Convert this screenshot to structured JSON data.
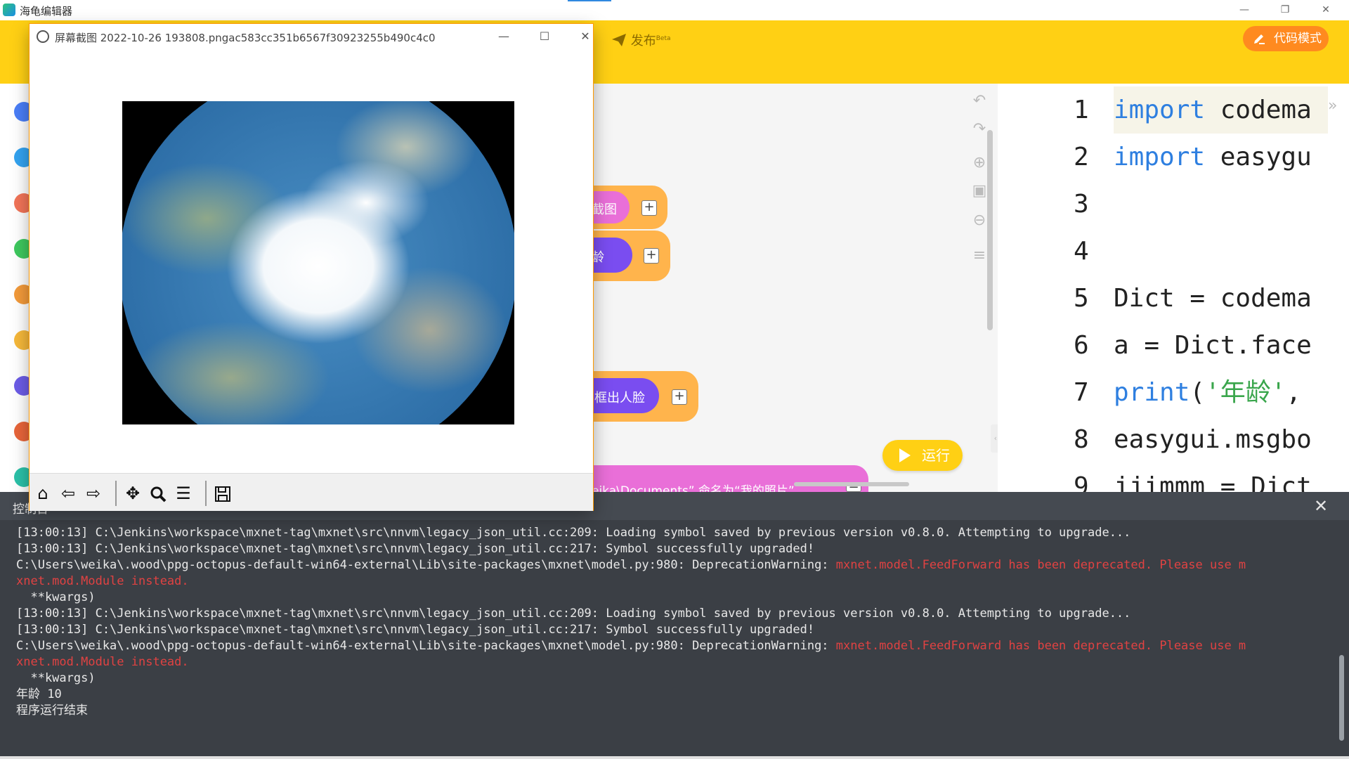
{
  "app": {
    "title": "海龟编辑器",
    "minimize": "—",
    "restore": "❐",
    "close": "✕"
  },
  "header": {
    "publish_label": "发布",
    "publish_badge": "Beta",
    "code_mode_label": "代码模式"
  },
  "sidebar": {
    "categories": [
      {
        "name": "category-1",
        "color": "#4a7ef7"
      },
      {
        "name": "category-2",
        "color": "#33a3f0"
      },
      {
        "name": "category-3",
        "color": "#f27458"
      },
      {
        "name": "category-4",
        "color": "#3ec85e"
      },
      {
        "name": "category-5",
        "color": "#f39a3a"
      },
      {
        "name": "category-6",
        "color": "#f6b83a"
      },
      {
        "name": "category-7",
        "color": "#6c5ce7"
      },
      {
        "name": "category-8",
        "color": "#e8653a"
      },
      {
        "name": "category-9",
        "color": "#2bc1a8"
      }
    ]
  },
  "blocks": {
    "b1": "截图",
    "b2": "龄",
    "b3": "框出人脸",
    "b4": "eika\\Documents” 命名为“我的照片”"
  },
  "run_button": "运行",
  "code": {
    "lines": [
      {
        "n": "1",
        "kw": "import",
        "rest": " codema"
      },
      {
        "n": "2",
        "kw": "import",
        "rest": " easygu"
      },
      {
        "n": "3",
        "kw": "",
        "rest": ""
      },
      {
        "n": "4",
        "kw": "",
        "rest": ""
      },
      {
        "n": "5",
        "kw": "",
        "rest": "Dict = codema"
      },
      {
        "n": "6",
        "kw": "",
        "rest": "a = Dict.face"
      },
      {
        "n": "7",
        "kw": "print",
        "str": "'年龄'",
        "rest": ","
      },
      {
        "n": "8",
        "kw": "",
        "rest": "easygui.msgbo"
      },
      {
        "n": "9",
        "kw": "",
        "rest": "jjimmm = Dict"
      }
    ]
  },
  "viewer": {
    "title": "屏幕截图 2022-10-26 193808.pngac583cc351b6567f30923255b490c4c0",
    "minimize": "—",
    "maximize": "☐",
    "close": "✕",
    "toolbar": [
      "home",
      "back",
      "forward",
      "pan",
      "zoom",
      "configure",
      "save"
    ]
  },
  "console": {
    "title": "控制台",
    "close": "✕",
    "lines": [
      {
        "t": "[13:00:13] C:\\Jenkins\\workspace\\mxnet-tag\\mxnet\\src\\nnvm\\legacy_json_util.cc:209: Loading symbol saved by previous version v0.8.0. Attempting to upgrade...",
        "e": ""
      },
      {
        "t": "[13:00:13] C:\\Jenkins\\workspace\\mxnet-tag\\mxnet\\src\\nnvm\\legacy_json_util.cc:217: Symbol successfully upgraded!",
        "e": ""
      },
      {
        "t": "C:\\Users\\weika\\.wood\\ppg-octopus-default-win64-external\\Lib\\site-packages\\mxnet\\model.py:980: DeprecationWarning: ",
        "e": "mxnet.model.FeedForward has been deprecated. Please use m"
      },
      {
        "t": "",
        "e": "xnet.mod.Module instead."
      },
      {
        "t": "  **kwargs)",
        "e": ""
      },
      {
        "t": "[13:00:13] C:\\Jenkins\\workspace\\mxnet-tag\\mxnet\\src\\nnvm\\legacy_json_util.cc:209: Loading symbol saved by previous version v0.8.0. Attempting to upgrade...",
        "e": ""
      },
      {
        "t": "[13:00:13] C:\\Jenkins\\workspace\\mxnet-tag\\mxnet\\src\\nnvm\\legacy_json_util.cc:217: Symbol successfully upgraded!",
        "e": ""
      },
      {
        "t": "C:\\Users\\weika\\.wood\\ppg-octopus-default-win64-external\\Lib\\site-packages\\mxnet\\model.py:980: DeprecationWarning: ",
        "e": "mxnet.model.FeedForward has been deprecated. Please use m"
      },
      {
        "t": "",
        "e": "xnet.mod.Module instead."
      },
      {
        "t": "  **kwargs)",
        "e": ""
      },
      {
        "t": "年龄 10",
        "e": ""
      },
      {
        "t": "程序运行结束",
        "e": ""
      }
    ]
  }
}
